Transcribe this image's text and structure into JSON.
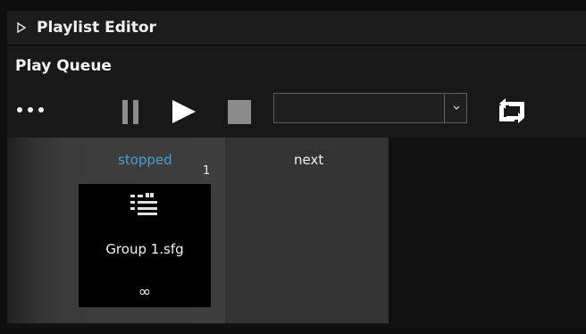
{
  "window": {
    "title": "Playlist Editor",
    "collapse_icon": "triangle-right-icon"
  },
  "queue": {
    "header": "Play Queue",
    "toolbar": {
      "more_icon": "ellipsis-icon",
      "pause_icon": "pause-icon",
      "play_icon": "play-icon",
      "stop_icon": "stop-icon",
      "playlist_select_value": "",
      "select_arrow_icon": "chevron-down-icon",
      "repeat_icon": "repeat-icon"
    },
    "current_slot": {
      "status": "stopped",
      "status_color": "#3fa3e0",
      "index": "1",
      "item": {
        "icon": "playlist-group-icon",
        "name": "Group 1.sfg",
        "loop_count": "∞"
      }
    },
    "next_slot": {
      "label": "next"
    }
  }
}
